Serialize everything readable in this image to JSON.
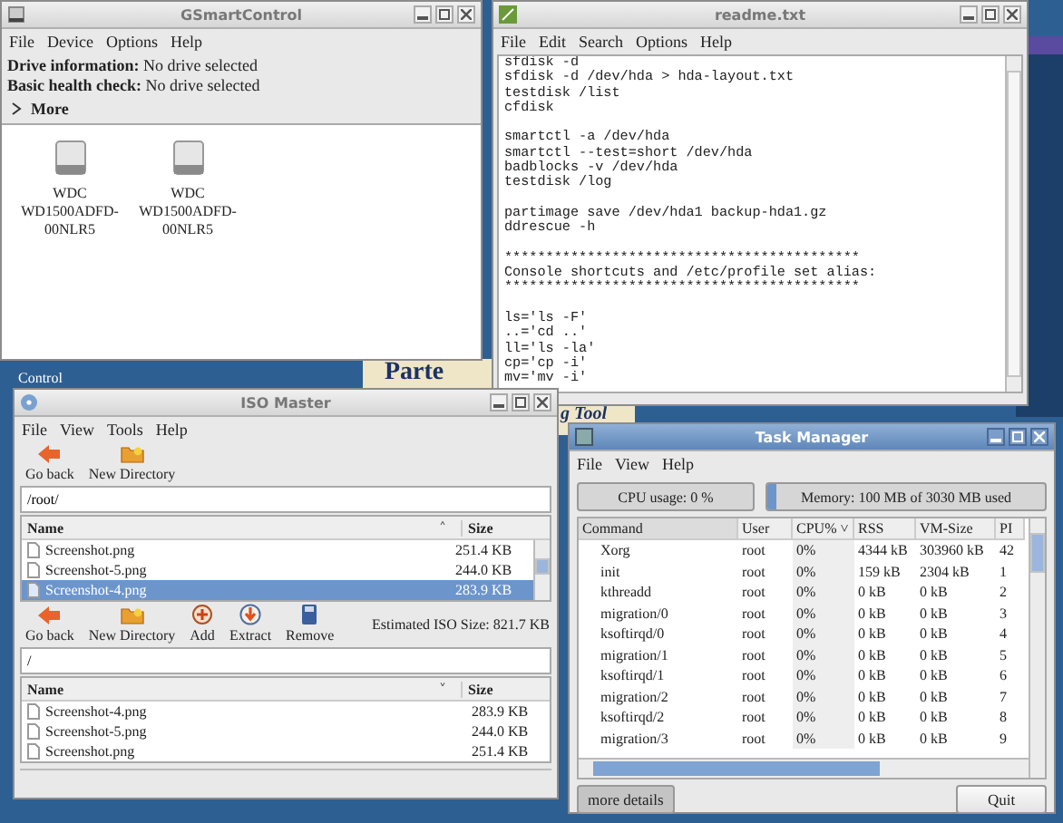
{
  "desktop": {
    "wallpaper_texts": [
      "Parte",
      "g Tool"
    ],
    "icon_label": "Control"
  },
  "gsmartcontrol": {
    "title": "GSmartControl",
    "active": false,
    "menu": [
      "File",
      "Device",
      "Options",
      "Help"
    ],
    "info": [
      {
        "label": "Drive information:",
        "value": "No drive selected"
      },
      {
        "label": "Basic health check:",
        "value": "No drive selected"
      }
    ],
    "expander": {
      "label": "More",
      "expanded": false
    },
    "drives": [
      {
        "label": "WDC\nWD1500ADFD-\n00NLR5"
      },
      {
        "label": "WDC\nWD1500ADFD-\n00NLR5"
      }
    ]
  },
  "readme": {
    "title": "readme.txt",
    "active": false,
    "menu": [
      "File",
      "Edit",
      "Search",
      "Options",
      "Help"
    ],
    "blocks": [
      [
        "sfdisk -d",
        "sfdisk -d /dev/hda > hda-layout.txt",
        "testdisk /list",
        "cfdisk"
      ],
      [
        "smartctl -a /dev/hda",
        "smartctl --test=short /dev/hda",
        "badblocks -v /dev/hda",
        "testdisk /log"
      ],
      [
        "partimage save /dev/hda1 backup-hda1.gz",
        "ddrescue -h"
      ],
      [
        "*******************************************",
        "Console shortcuts and /etc/profile set alias:",
        "*******************************************"
      ],
      [
        "ls='ls -F'",
        "..='cd ..'",
        "ll='ls -la'",
        "cp='cp -i'",
        "mv='mv -i'"
      ]
    ]
  },
  "iso_master": {
    "title": "ISO Master",
    "active": false,
    "menu": [
      "File",
      "View",
      "Tools",
      "Help"
    ],
    "top": {
      "tools": [
        {
          "kind": "back",
          "label": "Go back"
        },
        {
          "kind": "newdir",
          "label": "New Directory"
        }
      ],
      "path": "/root/",
      "columns": [
        {
          "label": "Name",
          "sort_caret": "˄"
        },
        {
          "label": "Size"
        }
      ],
      "rows": [
        {
          "name": "Screenshot.png",
          "size": "251.4 KB",
          "selected": false
        },
        {
          "name": "Screenshot-5.png",
          "size": "244.0 KB",
          "selected": false
        },
        {
          "name": "Screenshot-4.png",
          "size": "283.9 KB",
          "selected": true
        }
      ]
    },
    "bottom": {
      "tools": [
        {
          "kind": "back",
          "label": "Go back"
        },
        {
          "kind": "newdir",
          "label": "New Directory"
        },
        {
          "kind": "add",
          "label": "Add"
        },
        {
          "kind": "extract",
          "label": "Extract"
        },
        {
          "kind": "remove",
          "label": "Remove"
        }
      ],
      "estimate": "Estimated ISO Size: 821.7 KB",
      "path": "/",
      "columns": [
        {
          "label": "Name",
          "sort_caret": "˅"
        },
        {
          "label": "Size"
        }
      ],
      "rows": [
        {
          "name": "Screenshot-4.png",
          "size": "283.9 KB",
          "selected": false
        },
        {
          "name": "Screenshot-5.png",
          "size": "244.0 KB",
          "selected": false
        },
        {
          "name": "Screenshot.png",
          "size": "251.4 KB",
          "selected": false
        }
      ]
    }
  },
  "task_manager": {
    "title": "Task Manager",
    "active": true,
    "menu": [
      "File",
      "View",
      "Help"
    ],
    "cpu": {
      "label": "CPU usage: 0 %",
      "level": 0
    },
    "memory": {
      "label": "Memory: 100 MB of 3030 MB used",
      "level": 0.033
    },
    "columns": [
      {
        "label": "Command"
      },
      {
        "label": "User"
      },
      {
        "label": "CPU%",
        "sort_caret": "˅"
      },
      {
        "label": "RSS"
      },
      {
        "label": "VM-Size"
      },
      {
        "label": "PI"
      }
    ],
    "rows": [
      [
        "Xorg",
        "root",
        "0%",
        "4344 kB",
        "303960 kB",
        "42"
      ],
      [
        "init",
        "root",
        "0%",
        "159 kB",
        "2304 kB",
        "1"
      ],
      [
        "kthreadd",
        "root",
        "0%",
        "0 kB",
        "0 kB",
        "2"
      ],
      [
        "migration/0",
        "root",
        "0%",
        "0 kB",
        "0 kB",
        "3"
      ],
      [
        "ksoftirqd/0",
        "root",
        "0%",
        "0 kB",
        "0 kB",
        "4"
      ],
      [
        "migration/1",
        "root",
        "0%",
        "0 kB",
        "0 kB",
        "5"
      ],
      [
        "ksoftirqd/1",
        "root",
        "0%",
        "0 kB",
        "0 kB",
        "6"
      ],
      [
        "migration/2",
        "root",
        "0%",
        "0 kB",
        "0 kB",
        "7"
      ],
      [
        "ksoftirqd/2",
        "root",
        "0%",
        "0 kB",
        "0 kB",
        "8"
      ],
      [
        "migration/3",
        "root",
        "0%",
        "0 kB",
        "0 kB",
        "9"
      ]
    ],
    "buttons": [
      {
        "label": "more details",
        "pressed": true
      },
      {
        "label": "Quit",
        "pressed": false
      }
    ]
  }
}
